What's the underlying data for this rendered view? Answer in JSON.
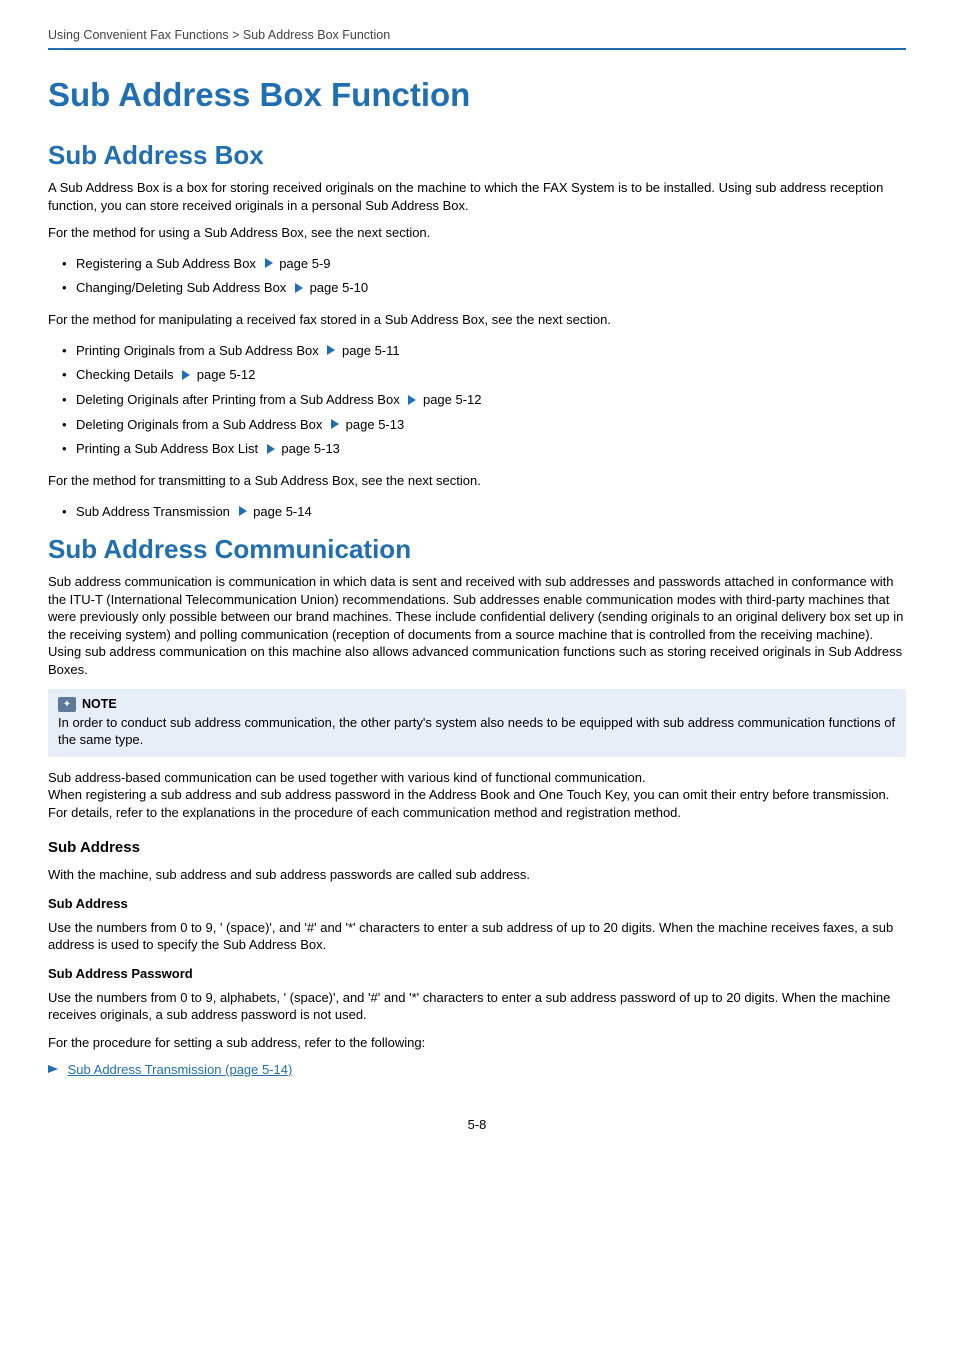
{
  "breadcrumb": "Using Convenient Fax Functions > Sub Address Box Function",
  "title_h1": "Sub Address Box Function",
  "section1": {
    "heading": "Sub Address Box",
    "intro": "A Sub Address Box is a box for storing received originals on the machine to which the FAX System is to be installed. Using sub address reception function, you can store received originals in a personal Sub Address Box.",
    "lead1": "For the method for using a Sub Address Box, see the next section.",
    "list1": [
      {
        "text": "Registering a Sub Address Box",
        "page": "page 5-9"
      },
      {
        "text": "Changing/Deleting Sub Address Box",
        "page": "page 5-10"
      }
    ],
    "lead2": "For the method for manipulating a received fax stored in a Sub Address Box, see the next section.",
    "list2": [
      {
        "text": "Printing Originals from a Sub Address Box",
        "page": "page 5-11"
      },
      {
        "text": "Checking Details",
        "page": "page 5-12"
      },
      {
        "text": "Deleting Originals after Printing from a Sub Address Box",
        "page": "page 5-12"
      },
      {
        "text": "Deleting Originals from a Sub Address Box",
        "page": "page 5-13"
      },
      {
        "text": "Printing a Sub Address Box List",
        "page": "page 5-13"
      }
    ],
    "lead3": "For the method for transmitting to a Sub Address Box, see the next section.",
    "list3": [
      {
        "text": "Sub Address Transmission",
        "page": "page 5-14"
      }
    ]
  },
  "section2": {
    "heading": "Sub Address Communication",
    "para": "Sub address communication is communication in which data is sent and received with sub addresses and passwords attached in conformance with the ITU-T (International Telecommunication Union) recommendations. Sub addresses enable communication modes with third-party machines that were previously only possible between our brand machines. These include confidential delivery (sending originals to an original delivery box set up in the receiving system) and polling communication (reception of documents from a source machine that is controlled from the receiving machine). Using sub address communication on this machine also allows advanced communication functions such as storing received originals in Sub Address Boxes.",
    "note_label": "NOTE",
    "note_text": "In order to conduct sub address communication, the other party's system also needs to be equipped with sub address communication functions of the same type.",
    "para2": "Sub address-based communication can be used together with various kind of functional communication.\nWhen registering a sub address and sub address password in the Address Book and One Touch Key, you can omit their entry before transmission. For details, refer to the explanations in the procedure of each communication method and registration method.",
    "h3": "Sub Address",
    "h3_text": "With the machine, sub address and sub address passwords are called sub address.",
    "h4a": "Sub Address",
    "h4a_text": "Use the numbers from 0 to 9, ' (space)', and '#' and '*' characters to enter a sub address of up to 20 digits. When the machine receives faxes, a sub address is used to specify the Sub Address Box.",
    "h4b": "Sub Address Password",
    "h4b_text": "Use the numbers from 0 to 9, alphabets, ' (space)', and '#' and '*' characters to enter a sub address password of up to 20 digits. When the machine receives originals, a sub address password is not used.",
    "procedure_lead": "For the procedure for setting a sub address, refer to the following:",
    "link_text": "Sub Address Transmission (page 5-14)"
  },
  "page_number": "5-8"
}
